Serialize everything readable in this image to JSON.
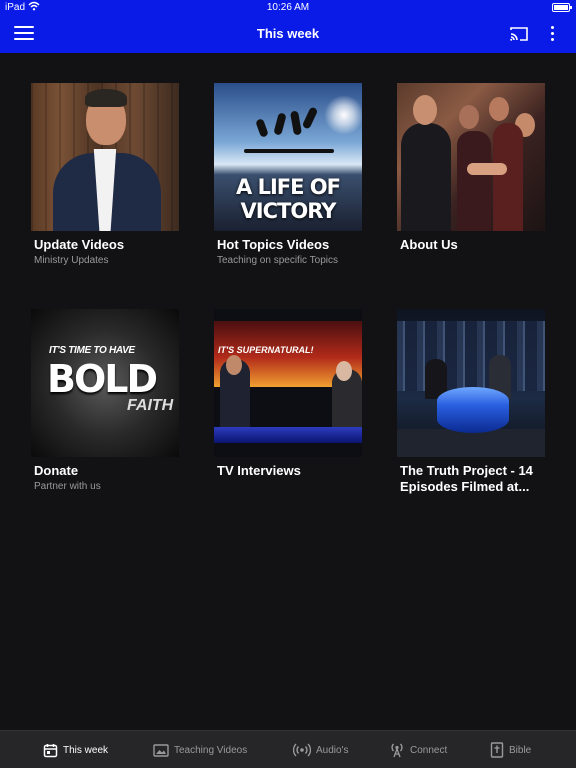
{
  "status_bar": {
    "carrier": "iPad",
    "time": "10:26 AM",
    "battery_level": 1.0
  },
  "header": {
    "title": "This week",
    "icons": [
      "menu-icon",
      "cast-icon",
      "more-vertical-icon"
    ]
  },
  "tiles": [
    {
      "title": "Update Videos",
      "subtitle": "Ministry Updates",
      "thumbnail": "man-in-suit-portrait"
    },
    {
      "title": "Hot Topics Videos",
      "subtitle": "Teaching on specific Topics",
      "thumbnail": "a-life-of-victory-art",
      "thumbnail_text": "A LIFE OF VICTORY"
    },
    {
      "title": "About Us",
      "subtitle": "",
      "thumbnail": "crowd-prayer-photo"
    },
    {
      "title": "Donate",
      "subtitle": "Partner with us",
      "thumbnail": "bold-faith-art",
      "thumbnail_text": {
        "line1": "IT'S TIME TO HAVE",
        "line2": "BOLD",
        "line3": "FAITH"
      }
    },
    {
      "title": "TV Interviews",
      "subtitle": "",
      "thumbnail": "tv-studio-interview",
      "thumbnail_text": "IT'S SUPERNATURAL!"
    },
    {
      "title": "The Truth Project - 14 Episodes Filmed at...",
      "subtitle": "",
      "thumbnail": "studio-round-table"
    }
  ],
  "tab_bar": {
    "items": [
      {
        "label": "This week",
        "icon": "calendar-icon",
        "active": true
      },
      {
        "label": "Teaching Videos",
        "icon": "image-icon",
        "active": false
      },
      {
        "label": "Audio's",
        "icon": "broadcast-icon",
        "active": false
      },
      {
        "label": "Connect",
        "icon": "antenna-icon",
        "active": false
      },
      {
        "label": "Bible",
        "icon": "bible-icon",
        "active": false
      }
    ]
  },
  "colors": {
    "header_bg": "#0a1be8",
    "page_bg": "#121214",
    "tabbar_bg": "#262629",
    "title_text": "#ffffff",
    "subtitle_text": "#9a9a9a"
  }
}
